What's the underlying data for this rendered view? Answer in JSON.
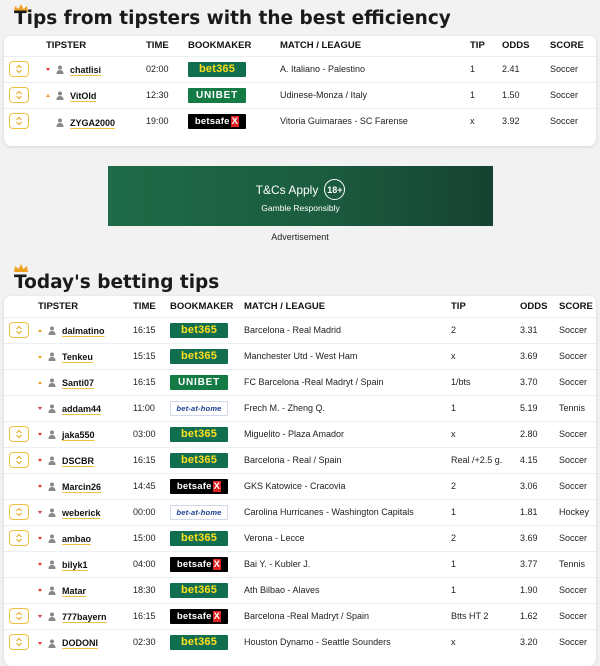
{
  "top_section": {
    "title": "Tips from tipsters with the best efficiency",
    "headers": {
      "tipster": "TIPSTER",
      "time": "TIME",
      "bookmaker": "BOOKMAKER",
      "match": "MATCH / LEAGUE",
      "tip": "TIP",
      "odds": "ODDS",
      "score": "SCORE"
    },
    "rows": [
      {
        "trend": "down",
        "tipster": "chatlisi",
        "time": "02:00",
        "bookmaker": "bet365",
        "match": "A. Italiano - Palestino",
        "tip": "1",
        "odds": "2.41",
        "sport": "Soccer"
      },
      {
        "trend": "up",
        "tipster": "VitOld",
        "time": "12:30",
        "bookmaker": "unibet",
        "match": "Udinese-Monza / Italy",
        "tip": "1",
        "odds": "1.50",
        "sport": "Soccer"
      },
      {
        "trend": "none",
        "tipster": "ZYGA2000",
        "time": "19:00",
        "bookmaker": "betsafe",
        "match": "Vitoria Guimaraes - SC Farense",
        "tip": "x",
        "odds": "3.92",
        "sport": "Soccer"
      }
    ]
  },
  "ad": {
    "main": "T&Cs Apply",
    "badge": "18+",
    "sub": "Gamble Responsibly",
    "label": "Advertisement"
  },
  "bookmaker_logos": {
    "bet365": {
      "text": "bet365"
    },
    "unibet": {
      "text": "UNIBET"
    },
    "betsafe": {
      "text": "betsafe",
      "mark": "X"
    },
    "betathome": {
      "text": "bet-at-home"
    }
  },
  "today_section": {
    "title": "Today's betting tips",
    "headers": {
      "tipster": "TIPSTER",
      "time": "TIME",
      "bookmaker": "BOOKMAKER",
      "match": "MATCH / LEAGUE",
      "tip": "TIP",
      "odds": "ODDS",
      "score": "SCORE"
    },
    "rows": [
      {
        "fav": true,
        "trend": "up",
        "tipster": "dalmatino",
        "time": "16:15",
        "bookmaker": "bet365",
        "match": "Barcelona - Real Madrid",
        "tip": "2",
        "odds": "3.31",
        "sport": "Soccer"
      },
      {
        "fav": false,
        "trend": "up",
        "tipster": "Tenkeu",
        "time": "15:15",
        "bookmaker": "bet365",
        "match": "Manchester Utd - West Ham",
        "tip": "x",
        "odds": "3.69",
        "sport": "Soccer"
      },
      {
        "fav": false,
        "trend": "up",
        "tipster": "Santi07",
        "time": "16:15",
        "bookmaker": "unibet",
        "match": "FC Barcelona -Real Madryt / Spain",
        "tip": "1/bts",
        "odds": "3.70",
        "sport": "Soccer"
      },
      {
        "fav": false,
        "trend": "down",
        "tipster": "addam44",
        "time": "11:00",
        "bookmaker": "betathome",
        "match": "Frech M. - Zheng Q.",
        "tip": "1",
        "odds": "5.19",
        "sport": "Tennis"
      },
      {
        "fav": true,
        "trend": "down",
        "tipster": "jaka550",
        "time": "03:00",
        "bookmaker": "bet365",
        "match": "Miguelito - Plaza Amador",
        "tip": "x",
        "odds": "2.80",
        "sport": "Soccer"
      },
      {
        "fav": true,
        "trend": "down",
        "tipster": "DSCBR",
        "time": "16:15",
        "bookmaker": "bet365",
        "match": "Barcelona - Real / Spain",
        "tip": "Real /+2.5 g.",
        "odds": "4.15",
        "sport": "Soccer"
      },
      {
        "fav": false,
        "trend": "down",
        "tipster": "Marcin26",
        "time": "14:45",
        "bookmaker": "betsafe",
        "match": "GKS Katowice - Cracovia",
        "tip": "2",
        "odds": "3.06",
        "sport": "Soccer"
      },
      {
        "fav": true,
        "trend": "down",
        "tipster": "weberick",
        "time": "00:00",
        "bookmaker": "betathome",
        "match": "Carolina Hurricanes - Washington Capitals",
        "tip": "1",
        "odds": "1.81",
        "sport": "Hockey"
      },
      {
        "fav": true,
        "trend": "down",
        "tipster": "ambao",
        "time": "15:00",
        "bookmaker": "bet365",
        "match": "Verona - Lecce",
        "tip": "2",
        "odds": "3.69",
        "sport": "Soccer"
      },
      {
        "fav": false,
        "trend": "down",
        "tipster": "bilyk1",
        "time": "04:00",
        "bookmaker": "betsafe",
        "match": "Bai Y. - Kubler J.",
        "tip": "1",
        "odds": "3.77",
        "sport": "Tennis"
      },
      {
        "fav": false,
        "trend": "down",
        "tipster": "Matar",
        "time": "18:30",
        "bookmaker": "bet365",
        "match": "Ath Bilbao - Alaves",
        "tip": "1",
        "odds": "1.90",
        "sport": "Soccer"
      },
      {
        "fav": true,
        "trend": "down",
        "tipster": "777bayern",
        "time": "16:15",
        "bookmaker": "betsafe",
        "match": "Barcelona -Real Madryt / Spain",
        "tip": "Btts HT 2",
        "odds": "1.62",
        "sport": "Soccer"
      },
      {
        "fav": true,
        "trend": "down",
        "tipster": "DODONI",
        "time": "02:30",
        "bookmaker": "bet365",
        "match": "Houston Dynamo - Seattle Sounders",
        "tip": "x",
        "odds": "3.20",
        "sport": "Soccer"
      }
    ]
  }
}
